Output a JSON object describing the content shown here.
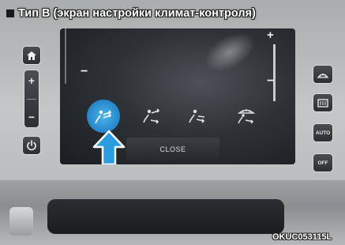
{
  "caption": {
    "text": "Тип B (экран настройки климат-контроля)"
  },
  "left_bezel": {
    "home_icon": "home-icon",
    "volume_plus": "+",
    "volume_minus": "−",
    "power_icon": "power-icon"
  },
  "screen": {
    "plus": "+",
    "minus_right": "−",
    "minus_left": "−",
    "modes": [
      {
        "icon": "airflow-face-icon",
        "selected": true
      },
      {
        "icon": "airflow-face-feet-icon",
        "selected": false
      },
      {
        "icon": "airflow-feet-icon",
        "selected": false
      },
      {
        "icon": "airflow-feet-defrost-icon",
        "selected": false
      }
    ],
    "close_label": "CLOSE",
    "pointer_icon": "arrow-up-icon"
  },
  "right_bezel": {
    "buttons": [
      {
        "icon": "front-defrost-icon",
        "label": ""
      },
      {
        "icon": "rear-defrost-icon",
        "label": ""
      },
      {
        "icon": "auto-icon",
        "label": "AUTO"
      },
      {
        "icon": "off-icon",
        "label": "OFF"
      }
    ]
  },
  "image_code": "OKUC053115L",
  "colors": {
    "selected_mode": "#2a8ccf",
    "screen_bg": "#2d3236",
    "pointer": "#2a9de0"
  }
}
